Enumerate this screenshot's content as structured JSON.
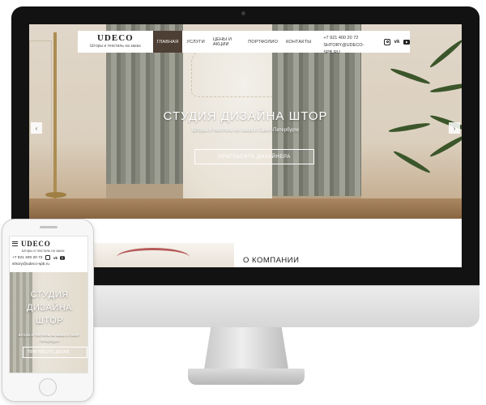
{
  "desktop": {
    "header": {
      "logo": "UDECO",
      "tagline": "Шторы и текстиль на заказ",
      "nav": [
        {
          "label": "ГЛАВНАЯ",
          "active": true
        },
        {
          "label": "УСЛУГИ",
          "active": false
        },
        {
          "label": "ЦЕНЫ И АКЦИИ",
          "active": false
        },
        {
          "label": "ПОРТФОЛИО",
          "active": false
        },
        {
          "label": "КОНТАКТЫ",
          "active": false
        }
      ],
      "phone": "+7 921 400 20 72",
      "email": "SHTORY@UDECO-SPB.RU",
      "social_icons": [
        "instagram-icon",
        "vk-icon",
        "youtube-icon"
      ]
    },
    "hero": {
      "title": "СТУДИЯ ДИЗАЙНА ШТОР",
      "subtitle": "Шторы и текстиль на заказ в Санкт-Петербурге",
      "button": "ПРИГЛАСИТЬ ДИЗАЙНЕРА",
      "prev_arrow": "‹",
      "next_arrow": "›"
    },
    "about": {
      "heading": "О КОМПАНИИ"
    }
  },
  "mobile": {
    "logo": "UDECO",
    "tagline": "Шторы и текстиль на заказ",
    "phone": "+7 921 400 20 72",
    "email": "shtory@udeco-spb.ru",
    "hero_title_lines": [
      "СТУДИЯ",
      "ДИЗАЙНА",
      "ШТОР"
    ],
    "hero_subtitle": "Шторы и текстиль на заказ в Санкт-Петербурге",
    "button": "ПРИГЛАСИТЬ ДИЗАЙ"
  },
  "colors": {
    "nav_active_bg": "#4e3f35",
    "bezel": "#121212",
    "curtain": "#8e8f84"
  }
}
